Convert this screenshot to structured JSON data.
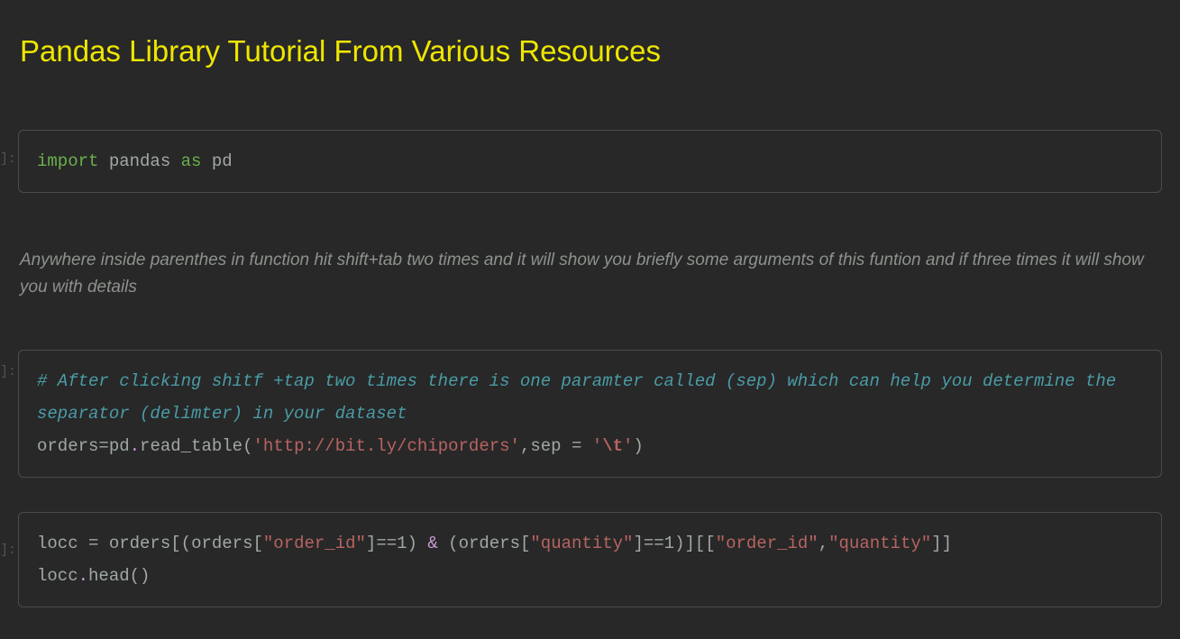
{
  "title": "Pandas Library Tutorial From Various Resources",
  "prompt_suffix": "]:",
  "cells": {
    "c1": {
      "kw_import": "import",
      "id_pandas": "pandas",
      "kw_as": "as",
      "id_pd": "pd"
    },
    "md1": {
      "text": "Anywhere inside parenthes in function hit shift+tab two times and it will show you briefly some arguments of this funtion and if three times it will show you with details"
    },
    "c2": {
      "cmt_line1": "# After clicking shitf +tap two times there is one paramter called (sep) which can help you determine the separator (delimter) in your dataset",
      "id_orders": "orders",
      "eq": "=",
      "id_pd": "pd",
      "dot": ".",
      "fn_read": "read_table",
      "lp": "(",
      "str_url": "'http://bit.ly/chiporders'",
      "comma": ",",
      "id_sep": "sep",
      "sp_eq": " = ",
      "str_q": "'",
      "str_t": "\\t",
      "rp": ")"
    },
    "c3": {
      "id_locc": "locc",
      "sp_eq": " = ",
      "id_orders": "orders",
      "lb": "[",
      "lp": "(",
      "id_orders2": "orders",
      "str_oid": "\"order_id\"",
      "rb": "]",
      "eqeq": "==",
      "n1": "1",
      "rp": ")",
      "amp": " & ",
      "str_qty": "\"quantity\"",
      "comma": ",",
      "line2_locc": "locc",
      "dot": ".",
      "fn_head": "head",
      "paren_pair": "()"
    }
  }
}
